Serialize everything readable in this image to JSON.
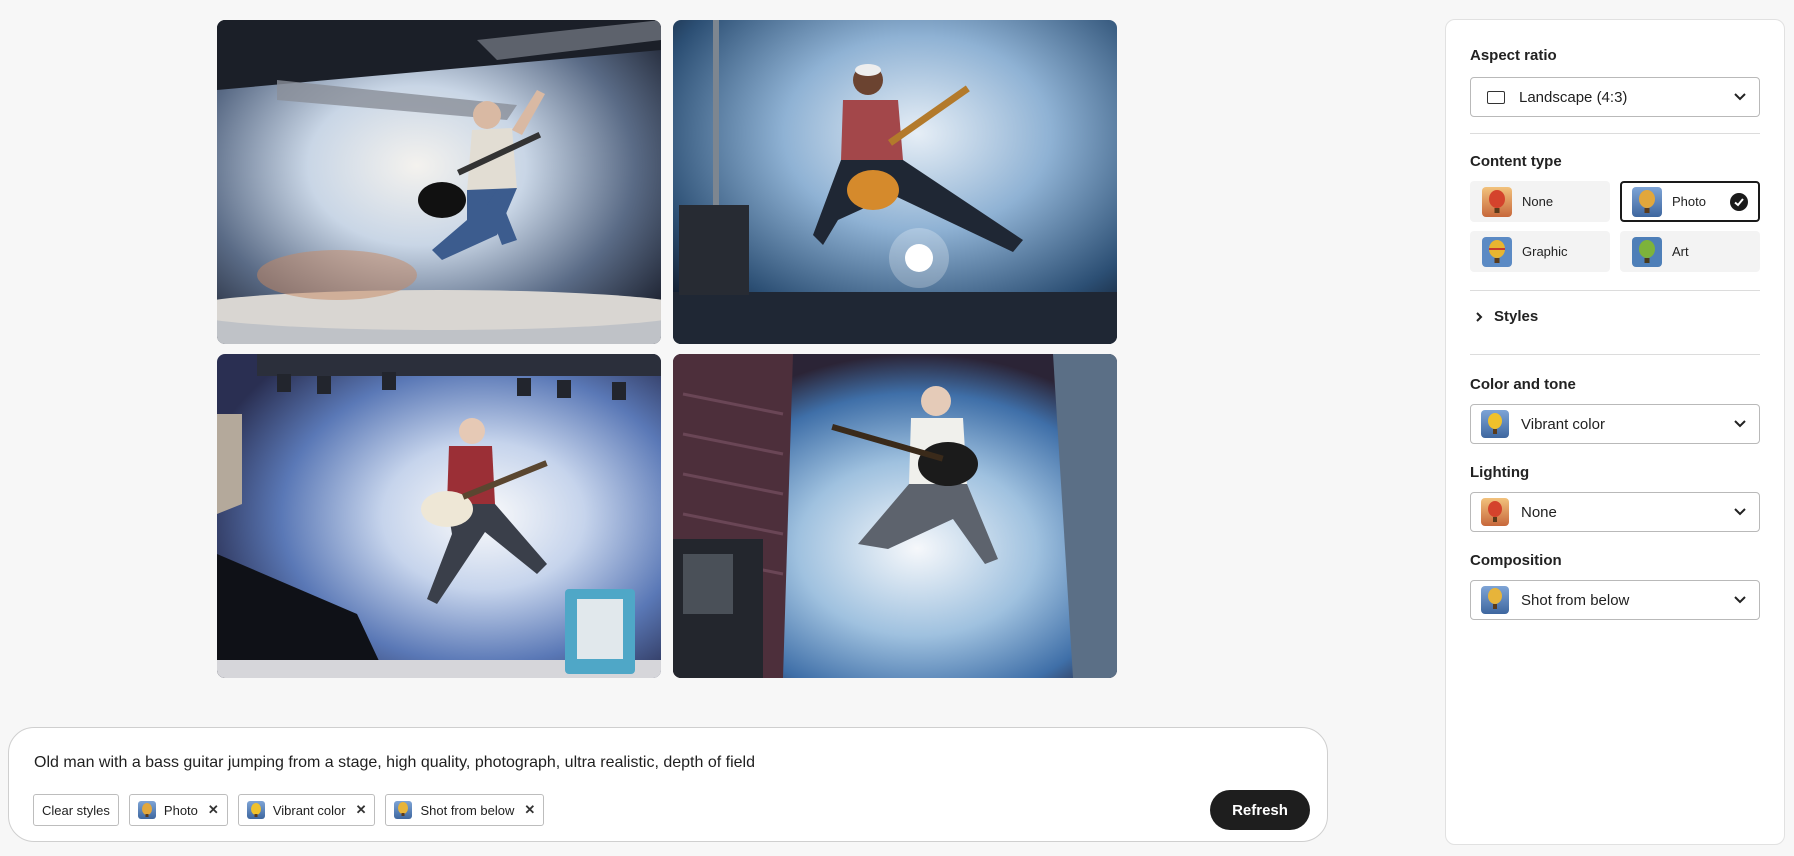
{
  "prompt": {
    "text": "Old man with a bass guitar jumping from a stage, high quality, photograph, ultra realistic, depth of field",
    "clear_label": "Clear styles",
    "chips": [
      {
        "label": "Photo",
        "icon": "balloon-photo-icon"
      },
      {
        "label": "Vibrant color",
        "icon": "balloon-vibrant-icon"
      },
      {
        "label": "Shot from below",
        "icon": "balloon-below-icon"
      }
    ],
    "refresh_label": "Refresh"
  },
  "images": [
    {
      "icon": "generated-image-1"
    },
    {
      "icon": "generated-image-2"
    },
    {
      "icon": "generated-image-3"
    },
    {
      "icon": "generated-image-4"
    }
  ],
  "panel": {
    "aspect_ratio": {
      "label": "Aspect ratio",
      "value": "Landscape (4:3)"
    },
    "content_type": {
      "label": "Content type",
      "options": [
        {
          "label": "None",
          "selected": false
        },
        {
          "label": "Photo",
          "selected": true
        },
        {
          "label": "Graphic",
          "selected": false
        },
        {
          "label": "Art",
          "selected": false
        }
      ]
    },
    "styles_label": "Styles",
    "color_tone": {
      "label": "Color and tone",
      "value": "Vibrant color"
    },
    "lighting": {
      "label": "Lighting",
      "value": "None"
    },
    "composition": {
      "label": "Composition",
      "value": "Shot from below"
    }
  },
  "colors": {
    "accent_dark": "#1e1e1e",
    "page_bg": "#f7f7f7",
    "stage_blue": "#3f6fa8"
  }
}
